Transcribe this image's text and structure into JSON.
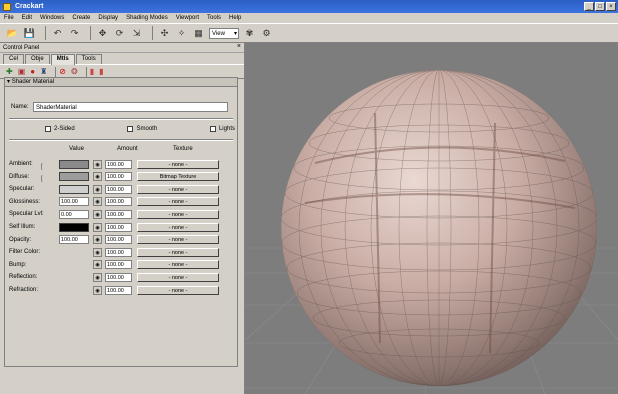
{
  "window": {
    "title": "Crackart"
  },
  "menu": [
    "File",
    "Edit",
    "Windows",
    "Create",
    "Display",
    "Shading Modes",
    "Viewport",
    "Tools",
    "Help"
  ],
  "toolbar": {
    "view_select": "View"
  },
  "panel": {
    "title": "Control Panel",
    "tabs": [
      "Cel",
      "Obje",
      "Mtls",
      "Tools"
    ],
    "section_title": "Shader Material",
    "name_label": "Name:",
    "name_value": "ShaderMaterial",
    "checkboxes": [
      "2-Sided",
      "Smooth",
      "Lights"
    ],
    "columns": {
      "value": "Value",
      "amount": "Amount",
      "texture": "Texture"
    },
    "properties": [
      {
        "label": "Ambient:",
        "kind": "color",
        "color": "#8a8a8a",
        "amount": "100.00",
        "texture": "- none -"
      },
      {
        "label": "Diffuse:",
        "kind": "color",
        "color": "#9c9c9c",
        "amount": "100.00",
        "texture": "Bitmap Texture"
      },
      {
        "label": "Specular:",
        "kind": "color",
        "color": "#cfcfcf",
        "amount": "100.00",
        "texture": "- none -"
      },
      {
        "label": "Glossiness:",
        "kind": "number",
        "value": "100.00",
        "amount": "100.00",
        "texture": "- none -"
      },
      {
        "label": "Specular Lvl:",
        "kind": "number",
        "value": "0.00",
        "amount": "100.00",
        "texture": "- none -"
      },
      {
        "label": "Self Illum:",
        "kind": "color",
        "color": "#000000",
        "amount": "100.00",
        "texture": "- none -"
      },
      {
        "label": "Opacity:",
        "kind": "number",
        "value": "100.00",
        "amount": "100.00",
        "texture": "- none -"
      },
      {
        "label": "Filter Color:",
        "kind": "none",
        "amount": "100.00",
        "texture": "- none -"
      },
      {
        "label": "Bump:",
        "kind": "none",
        "amount": "100.00",
        "texture": "- none -"
      },
      {
        "label": "Reflection:",
        "kind": "none",
        "amount": "100.00",
        "texture": "- none -"
      },
      {
        "label": "Refraction:",
        "kind": "none",
        "amount": "100.00",
        "texture": "- none -"
      }
    ]
  },
  "colors": {
    "titlebar": "#3b73e0",
    "viewport_bg": "#7d7d7d",
    "sphere": "#c8aca4"
  }
}
